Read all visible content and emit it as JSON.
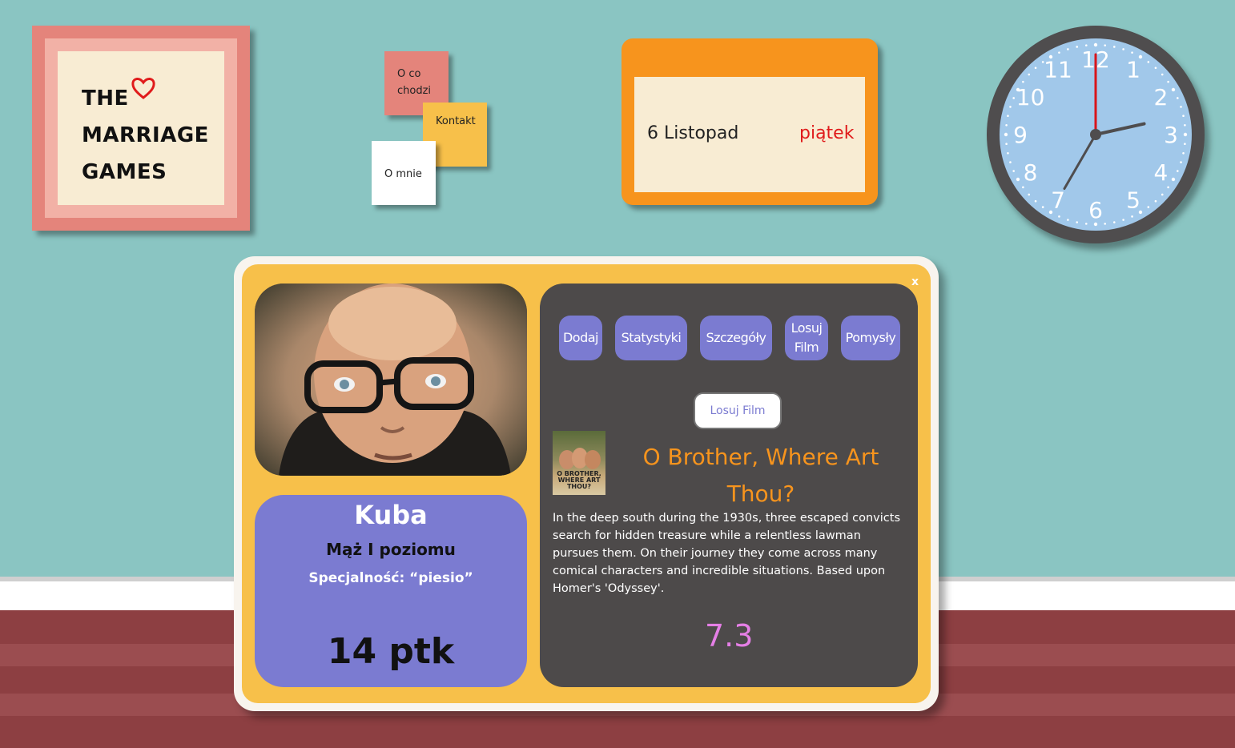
{
  "frame": {
    "line1": "THE",
    "line2": "MARRIAGE",
    "line3": "GAMES"
  },
  "notes": {
    "o_co_chodzi": "O co chodzi",
    "kontakt": "Kontakt",
    "o_mnie": "O mnie"
  },
  "calendar": {
    "date": "6 Listopad",
    "day": "piątek"
  },
  "clock": {
    "numbers": [
      "12",
      "1",
      "2",
      "3",
      "4",
      "5",
      "6",
      "7",
      "8",
      "9",
      "10",
      "11"
    ],
    "time": {
      "hour": 2,
      "minute": 35,
      "second": 0
    }
  },
  "modal": {
    "close_label": "x",
    "profile": {
      "name": "Kuba",
      "rank": "Mąż I poziomu",
      "specialty": "Specjalność: “piesio”",
      "points": "14 ptk"
    },
    "nav": {
      "dodaj": "Dodaj",
      "statystyki": "Statystyki",
      "szczegoly": "Szczegóły",
      "losuj_film": "Losuj Film",
      "pomysly": "Pomysły"
    },
    "random_button": "Losuj Film",
    "movie": {
      "poster_label": "O BROTHER, WHERE ART THOU?",
      "title": "O Brother, Where Art Thou?",
      "description": "In the deep south during the 1930s, three escaped convicts search for hidden treasure while a relentless lawman pursues them. On their journey they come across many comical characters and incredible situations. Based upon Homer's 'Odyssey'.",
      "rating": "7.3"
    }
  },
  "colors": {
    "wall": "#8ac5c2",
    "floor": "#8d3f42",
    "modal": "#f7c04a",
    "panel": "#4d4a4a",
    "accent": "#7b7bd1",
    "title": "#f7941d",
    "rating": "#e57fe6"
  }
}
